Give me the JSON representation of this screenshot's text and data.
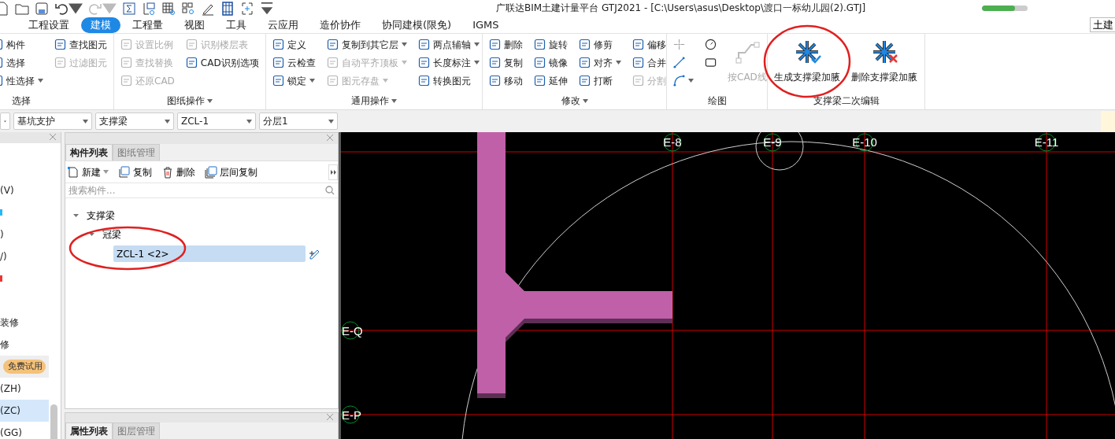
{
  "window": {
    "title": "广联达BIM土建计量平台 GTJ2021 - [C:\\Users\\asus\\Desktop\\渡口一标幼儿园(2).GTJ]"
  },
  "progress": {
    "level": 0.72
  },
  "menu_tabs": [
    {
      "label": "工程设置",
      "selected": false
    },
    {
      "label": "建模",
      "selected": true
    },
    {
      "label": "工程量",
      "selected": false
    },
    {
      "label": "视图",
      "selected": false
    },
    {
      "label": "工具",
      "selected": false
    },
    {
      "label": "云应用",
      "selected": false
    },
    {
      "label": "造价协作",
      "selected": false
    },
    {
      "label": "协同建模(限免)",
      "selected": false
    },
    {
      "label": "IGMS",
      "selected": false
    }
  ],
  "corner_tab": {
    "label": "土建"
  },
  "ribbon": {
    "groups": [
      {
        "label": "选择",
        "dropdown": false,
        "columns": [
          [
            {
              "kind": "small",
              "label": "构件",
              "disabled": false,
              "dropdown": false
            },
            {
              "kind": "small",
              "label": "选择",
              "disabled": false,
              "dropdown": false
            },
            {
              "kind": "small",
              "label": "性选择",
              "disabled": false,
              "dropdown": true
            }
          ],
          [
            {
              "kind": "small",
              "label": "查找图元",
              "disabled": false,
              "dropdown": false
            },
            {
              "kind": "small",
              "label": "过滤图元",
              "disabled": true,
              "dropdown": false
            }
          ]
        ]
      },
      {
        "label": "图纸操作",
        "dropdown": true,
        "columns": [
          [
            {
              "kind": "small",
              "label": "设置比例",
              "disabled": true,
              "dropdown": false
            },
            {
              "kind": "small",
              "label": "查找替换",
              "disabled": true,
              "dropdown": false
            },
            {
              "kind": "small",
              "label": "还原CAD",
              "disabled": true,
              "dropdown": false
            }
          ],
          [
            {
              "kind": "small",
              "label": "识别楼层表",
              "disabled": true,
              "dropdown": false
            },
            {
              "kind": "small",
              "label": "CAD识别选项",
              "disabled": false,
              "dropdown": false
            }
          ]
        ]
      },
      {
        "label": "通用操作",
        "dropdown": true,
        "columns": [
          [
            {
              "kind": "small",
              "label": "定义",
              "disabled": false,
              "dropdown": false
            },
            {
              "kind": "small",
              "label": "云检查",
              "disabled": false,
              "dropdown": false
            },
            {
              "kind": "small",
              "label": "锁定",
              "disabled": false,
              "dropdown": true
            }
          ],
          [
            {
              "kind": "small",
              "label": "复制到其它层",
              "disabled": false,
              "dropdown": true
            },
            {
              "kind": "small",
              "label": "自动平齐顶板",
              "disabled": true,
              "dropdown": true
            },
            {
              "kind": "small",
              "label": "图元存盘",
              "disabled": true,
              "dropdown": true
            }
          ],
          [
            {
              "kind": "small",
              "label": "两点辅轴",
              "disabled": false,
              "dropdown": true
            },
            {
              "kind": "small",
              "label": "长度标注",
              "disabled": false,
              "dropdown": true
            },
            {
              "kind": "small",
              "label": "转换图元",
              "disabled": false,
              "dropdown": false
            }
          ]
        ]
      },
      {
        "label": "修改",
        "dropdown": true,
        "columns": [
          [
            {
              "kind": "small",
              "label": "删除",
              "disabled": false,
              "dropdown": false
            },
            {
              "kind": "small",
              "label": "复制",
              "disabled": false,
              "dropdown": false
            },
            {
              "kind": "small",
              "label": "移动",
              "disabled": false,
              "dropdown": false
            }
          ],
          [
            {
              "kind": "small",
              "label": "旋转",
              "disabled": false,
              "dropdown": false
            },
            {
              "kind": "small",
              "label": "镜像",
              "disabled": false,
              "dropdown": false
            },
            {
              "kind": "small",
              "label": "延伸",
              "disabled": false,
              "dropdown": false
            }
          ],
          [
            {
              "kind": "small",
              "label": "修剪",
              "disabled": false,
              "dropdown": false
            },
            {
              "kind": "small",
              "label": "对齐",
              "disabled": false,
              "dropdown": true
            },
            {
              "kind": "small",
              "label": "打断",
              "disabled": false,
              "dropdown": false
            }
          ],
          [
            {
              "kind": "small",
              "label": "偏移",
              "disabled": false,
              "dropdown": false
            },
            {
              "kind": "small",
              "label": "合并",
              "disabled": false,
              "dropdown": false
            },
            {
              "kind": "small",
              "label": "分割",
              "disabled": true,
              "dropdown": false
            }
          ]
        ]
      },
      {
        "label": "绘图",
        "dropdown": false,
        "columns": [
          [
            {
              "kind": "icon",
              "disabled": false,
              "dropdown": false
            },
            {
              "kind": "icon",
              "disabled": false,
              "dropdown": false
            },
            {
              "kind": "icon",
              "disabled": false,
              "dropdown": true
            }
          ],
          [
            {
              "kind": "icon",
              "disabled": false,
              "dropdown": false
            },
            {
              "kind": "icon",
              "disabled": false,
              "dropdown": false
            }
          ],
          [
            {
              "kind": "large",
              "label": "按CAD线",
              "disabled": true,
              "dropdown": false
            }
          ]
        ]
      },
      {
        "label": "支撑梁二次编辑",
        "dropdown": false,
        "columns": [
          [
            {
              "kind": "large",
              "label": "生成支撑梁加腋",
              "disabled": false,
              "dropdown": false
            }
          ],
          [
            {
              "kind": "large",
              "label": "删除支撑梁加腋",
              "disabled": false,
              "dropdown": false
            }
          ]
        ]
      }
    ]
  },
  "toolbar": {
    "selectors": [
      {
        "value": "基坑支护"
      },
      {
        "value": "支撑梁"
      },
      {
        "value": "ZCL-1"
      },
      {
        "value": "分层1"
      }
    ]
  },
  "nav_panel": {
    "rows": [
      {
        "kind": "text",
        "text": "(V)",
        "selected": false
      },
      {
        "kind": "mark",
        "color": "#29b6f6",
        "selected": false
      },
      {
        "kind": "text",
        "text": ")",
        "selected": false
      },
      {
        "kind": "text",
        "text": "/)",
        "selected": false
      },
      {
        "kind": "mark",
        "color": "#e53935",
        "selected": false
      },
      {
        "kind": "text",
        "text": "装修",
        "selected": false
      },
      {
        "kind": "text",
        "text": "修",
        "selected": false
      },
      {
        "kind": "badge",
        "text": "免费试用",
        "selected": false
      },
      {
        "kind": "text",
        "text": "(ZH)",
        "selected": false
      },
      {
        "kind": "text",
        "text": "(ZC)",
        "selected": true
      },
      {
        "kind": "text",
        "text": "(GG)",
        "selected": false
      }
    ]
  },
  "component_panel": {
    "tabs": [
      {
        "label": "构件列表",
        "selected": true
      },
      {
        "label": "图纸管理",
        "selected": false
      }
    ],
    "actions": [
      {
        "label": "新建",
        "dropdown": true
      },
      {
        "label": "复制",
        "dropdown": false
      },
      {
        "label": "删除",
        "dropdown": false
      },
      {
        "label": "层间复制",
        "dropdown": false
      }
    ],
    "search": {
      "placeholder": "搜索构件..."
    },
    "tree": [
      {
        "label": "支撑梁",
        "expanded": true,
        "selected": false,
        "children": [
          {
            "label": "冠梁",
            "expanded": true,
            "selected": false,
            "children": [
              {
                "label": "ZCL-1 <2>",
                "selected": true
              }
            ]
          }
        ]
      }
    ]
  },
  "property_panel": {
    "tabs": [
      {
        "label": "属性列表",
        "selected": true
      },
      {
        "label": "图层管理",
        "selected": false
      }
    ]
  },
  "canvas": {
    "column_axes": [
      {
        "label": "E-8"
      },
      {
        "label": "E-9"
      },
      {
        "label": "E-10"
      },
      {
        "label": "E-11"
      }
    ],
    "row_axes": [
      {
        "label": "E-Q"
      },
      {
        "label": "E-P"
      }
    ]
  }
}
